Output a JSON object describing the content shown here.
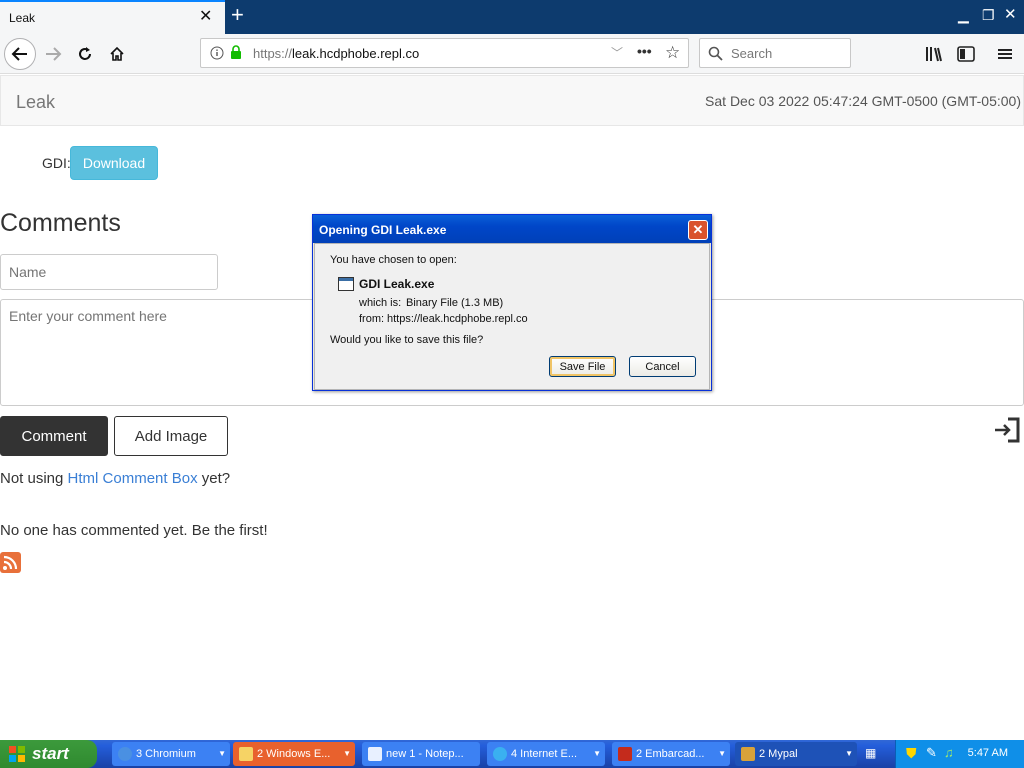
{
  "browser": {
    "tab_title": "Leak",
    "url_prefix": "https://",
    "url_host": "leak.hcdphobe.repl.co",
    "search_placeholder": "Search"
  },
  "page": {
    "brand": "Leak",
    "datetime": "Sat Dec 03 2022 05:47:24 GMT-0500 (GMT-05:00)",
    "gdi_label": "GDI:",
    "download_label": "Download",
    "comments_heading": "Comments",
    "name_placeholder": "Name",
    "comment_placeholder": "Enter your comment here",
    "comment_button": "Comment",
    "add_image_button": "Add Image",
    "promo_prefix": "Not using",
    "promo_link": "Html Comment Box",
    "promo_suffix": "yet?",
    "no_comments": "No one has commented yet. Be the first!"
  },
  "dialog": {
    "title": "Opening GDI Leak.exe",
    "chosen": "You have chosen to open:",
    "filename": "GDI Leak.exe",
    "which_is_label": "which is:",
    "which_is_value": "Binary File (1.3 MB)",
    "from_label": "from:",
    "from_value": "https://leak.hcdphobe.repl.co",
    "question": "Would you like to save this file?",
    "save_button": "Save File",
    "cancel_button": "Cancel"
  },
  "taskbar": {
    "start_label": "start",
    "items": [
      {
        "label": "3 Chromium",
        "icon": "chromium-icon"
      },
      {
        "label": "2 Windows E...",
        "icon": "folder-icon"
      },
      {
        "label": "new 1 - Notep...",
        "icon": "notepad-icon"
      },
      {
        "label": "4 Internet E...",
        "icon": "ie-icon"
      },
      {
        "label": "2 Embarcad...",
        "icon": "embarcadero-icon"
      },
      {
        "label": "2 Mypal",
        "icon": "mypal-icon"
      }
    ],
    "clock": "5:47 AM"
  },
  "colors": {
    "accent": "#5bc0de",
    "link": "#3a7fd5",
    "titlebar": "#0d3b6e",
    "taskbar": "#245edb"
  }
}
